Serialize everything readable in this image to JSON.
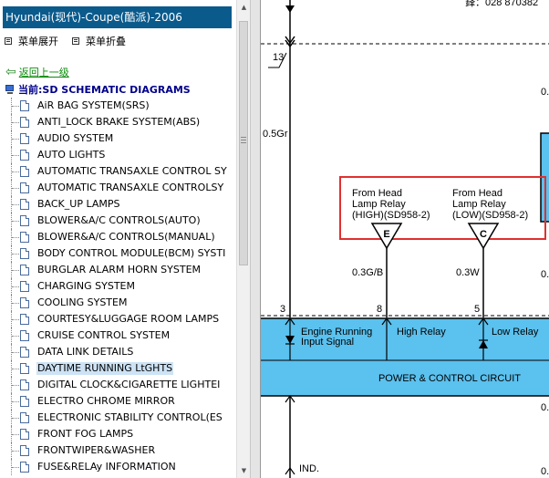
{
  "window": {
    "title": "Hyundai(现代)-Coupe(酷派)-2006"
  },
  "menu": {
    "expand": "菜单展开",
    "collapse": "菜单折叠"
  },
  "nav": {
    "back": "返回上一级",
    "current": "当前:SD SCHEMATIC DIAGRAMS"
  },
  "tree": {
    "items": [
      "AiR BAG SYSTEM(SRS)",
      "ANTI_LOCK BRAKE SYSTEM(ABS)",
      "AUDIO SYSTEM",
      "AUTO LIGHTS",
      "AUTOMATIC TRANSAXLE CONTROL SY",
      "AUTOMATIC TRANSAXLE CONTROLSY",
      "BACK_UP LAMPS",
      "BLOWER&A/C CONTROLS(AUTO)",
      "BLOWER&A/C CONTROLS(MANUAL)",
      "BODY CONTROL MODULE(BCM) SYSTI",
      "BURGLAR ALARM HORN SYSTEM",
      "CHARGING SYSTEM",
      "COOLING SYSTEM",
      "COURTESY&LUGGAGE ROOM LAMPS",
      "CRUISE CONTROL SYSTEM",
      "DATA LINK DETAILS",
      "DAYTIME RUNNING LtGHTS",
      "DIGITAL CLOCK&CIGARETTE LIGHTEI",
      "ELECTRO CHROME MIRROR",
      "ELECTRONIC STABILITY CONTROL(ES",
      "FRONT FOG LAMPS",
      "FRONTWIPER&WASHER",
      "FUSE&RELAy INFORMATION"
    ],
    "selected_index": 16
  },
  "schematic": {
    "top_text": "鋒：028 870382",
    "pin_13": "13",
    "wire_left": "0.5Gr",
    "relay_high": {
      "line1": "From Head",
      "line2": "Lamp Relay",
      "line3": "(HIGH)(SD958-2)",
      "letter": "E"
    },
    "relay_low": {
      "line1": "From Head",
      "line2": "Lamp Relay",
      "line3": "(LOW)(SD958-2)",
      "letter": "C"
    },
    "wire_high": "0.3G/B",
    "wire_low": "0.3W",
    "pin_3": "3",
    "pin_8": "8",
    "pin_5": "5",
    "label_engine1": "Engine Running",
    "label_engine2": "Input Signal",
    "label_high": "High Relay",
    "label_low": "Low Relay",
    "circuit": "POWER & CONTROL CIRCUIT",
    "ind": "IND.",
    "right_edge_1": "0.",
    "right_edge_2": "0.",
    "right_edge_3": "0.",
    "right_edge_4": "0.",
    "accent_blue": "#5bc1ee",
    "highlight_red": "#e03030"
  }
}
